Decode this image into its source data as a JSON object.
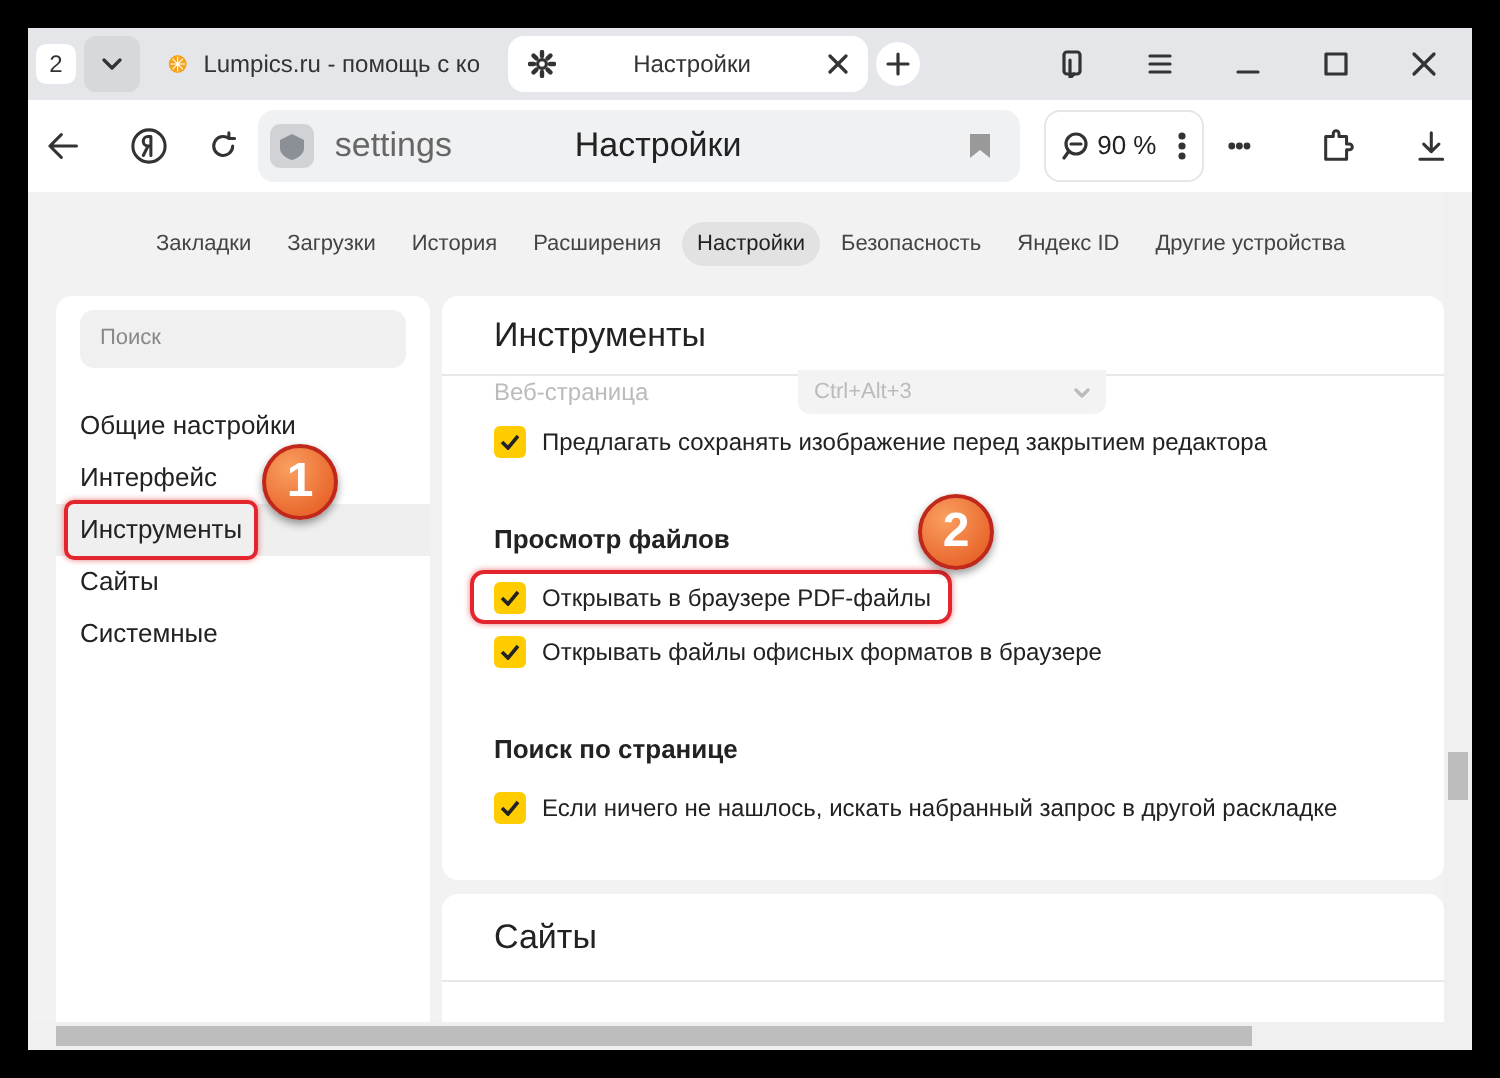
{
  "tab_strip": {
    "tab_count": "2",
    "tabs": [
      {
        "kind": "site",
        "title": "Lumpics.ru - помощь с ко",
        "selected": false
      },
      {
        "kind": "settings",
        "title": "Настройки",
        "selected": true
      }
    ]
  },
  "address_bar": {
    "host": "settings",
    "page_title": "Настройки",
    "zoom": "90 %"
  },
  "settings_nav": [
    {
      "label": "Закладки",
      "selected": false
    },
    {
      "label": "Загрузки",
      "selected": false
    },
    {
      "label": "История",
      "selected": false
    },
    {
      "label": "Расширения",
      "selected": false
    },
    {
      "label": "Настройки",
      "selected": true
    },
    {
      "label": "Безопасность",
      "selected": false
    },
    {
      "label": "Яндекс ID",
      "selected": false
    },
    {
      "label": "Другие устройства",
      "selected": false
    }
  ],
  "sidebar": {
    "search_placeholder": "Поиск",
    "items": [
      {
        "label": "Общие настройки",
        "selected": false,
        "highlighted": false
      },
      {
        "label": "Интерфейс",
        "selected": false,
        "highlighted": false
      },
      {
        "label": "Инструменты",
        "selected": true,
        "highlighted": true,
        "callout": "1"
      },
      {
        "label": "Сайты",
        "selected": false,
        "highlighted": false
      },
      {
        "label": "Системные",
        "selected": false,
        "highlighted": false
      }
    ]
  },
  "section": {
    "title": "Инструменты",
    "rows": [
      {
        "kind": "dropdown",
        "label": "Веб-страница",
        "value": "Ctrl+Alt+3",
        "disabled": true
      },
      {
        "kind": "checkbox",
        "label": "Предлагать сохранять изображение перед закрытием редактора",
        "checked": true,
        "highlighted": false
      },
      {
        "kind": "heading",
        "label": "Просмотр файлов"
      },
      {
        "kind": "checkbox",
        "label": "Открывать в браузере PDF-файлы",
        "checked": true,
        "highlighted": true,
        "callout": "2"
      },
      {
        "kind": "checkbox",
        "label": "Открывать файлы офисных форматов в браузере",
        "checked": true,
        "highlighted": false
      },
      {
        "kind": "heading",
        "label": "Поиск по странице"
      },
      {
        "kind": "checkbox",
        "label": "Если ничего не нашлось, искать набранный запрос в другой раскладке",
        "checked": true,
        "highlighted": false
      }
    ]
  },
  "next_section": {
    "title": "Сайты"
  }
}
